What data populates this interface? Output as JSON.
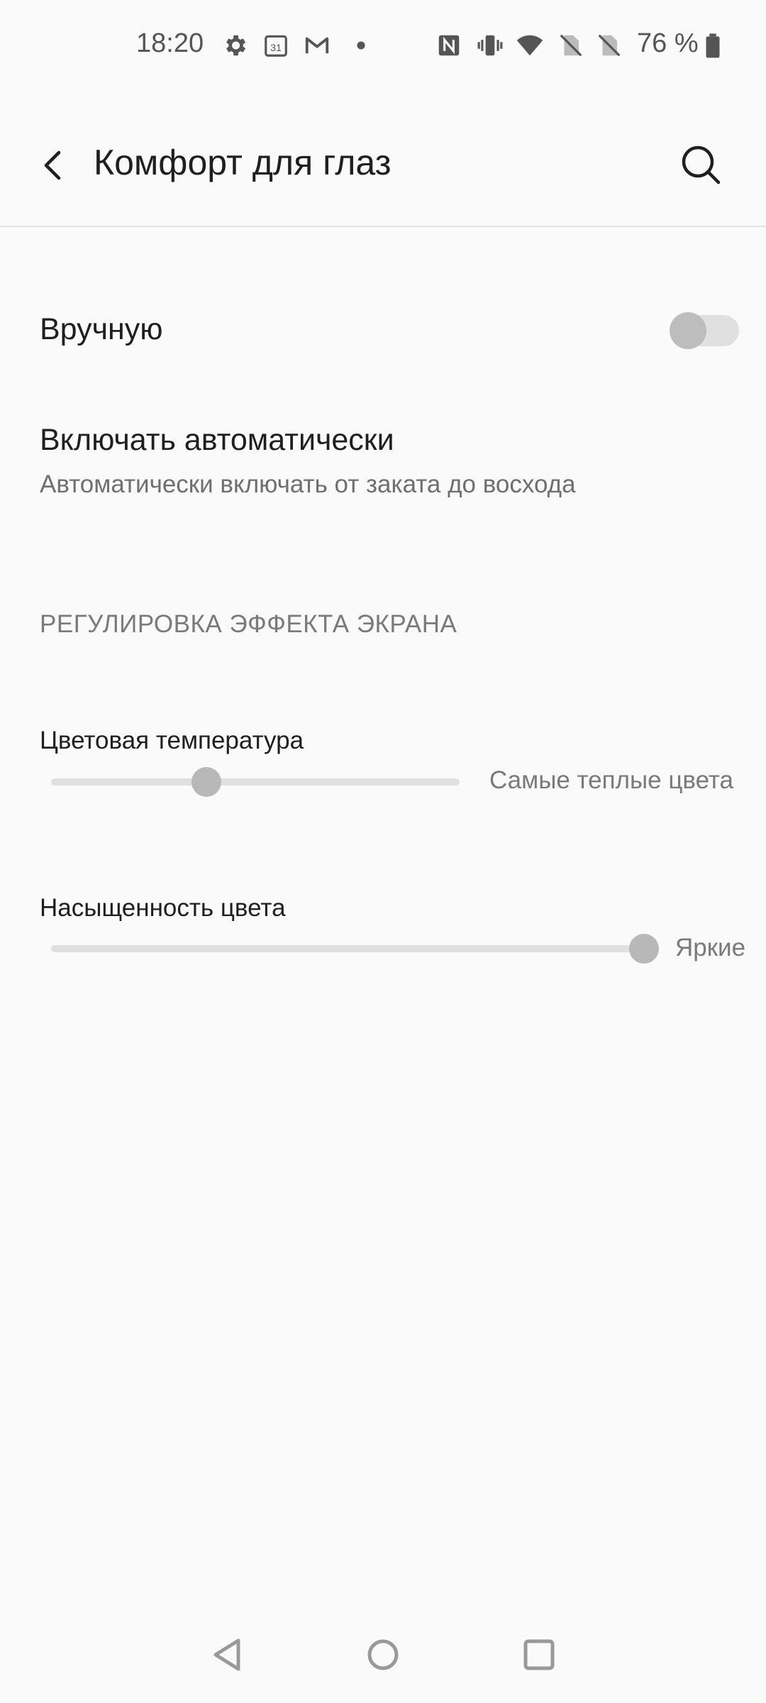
{
  "status_bar": {
    "time": "18:20",
    "battery": "76 %",
    "icons": [
      "settings-icon",
      "calendar-icon",
      "gmail-icon",
      "dot-icon",
      "nfc-icon",
      "vibrate-icon",
      "wifi-icon",
      "no-sim-icon",
      "no-sim-icon",
      "battery-icon"
    ],
    "calendar_day": "31"
  },
  "app_bar": {
    "title": "Комфорт для глаз"
  },
  "settings": {
    "manual": {
      "title": "Вручную",
      "enabled": false
    },
    "auto": {
      "title": "Включать автоматически",
      "subtitle": "Автоматически включать от заката до восхода"
    },
    "section_header": "РЕГУЛИРОВКА ЭФФЕКТА ЭКРАНА",
    "color_temperature": {
      "label": "Цветовая температура",
      "value_label": "Самые теплые цвета",
      "level": 0.38
    },
    "saturation": {
      "label": "Насыщенность цвета",
      "value_label": "Яркие",
      "level": 1.0
    }
  },
  "nav_bar": {
    "buttons": [
      "back-nav-icon",
      "home-nav-icon",
      "recents-nav-icon"
    ]
  },
  "colors": {
    "background": "#fafafa",
    "text_primary": "#1f1f1f",
    "text_secondary": "#6f6f6f",
    "track": "#e0e0e0",
    "thumb": "#b8b8b8"
  }
}
